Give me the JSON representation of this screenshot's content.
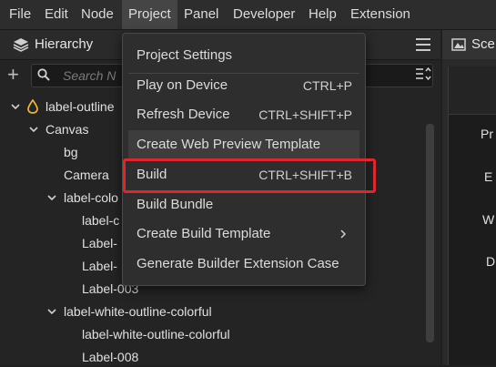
{
  "menubar": {
    "items": [
      "File",
      "Edit",
      "Node",
      "Project",
      "Panel",
      "Developer",
      "Help",
      "Extension"
    ]
  },
  "hierarchy": {
    "title": "Hierarchy",
    "search_placeholder": "Search N",
    "tree": [
      {
        "label": "label-outline"
      },
      {
        "label": "Canvas"
      },
      {
        "label": "bg"
      },
      {
        "label": "Camera"
      },
      {
        "label": "label-colo"
      },
      {
        "label": "label-c"
      },
      {
        "label": "Label-"
      },
      {
        "label": "Label-"
      },
      {
        "label": "Label-003"
      },
      {
        "label": "label-white-outline-colorful"
      },
      {
        "label": "label-white-outline-colorful"
      },
      {
        "label": "Label-008"
      }
    ]
  },
  "scene": {
    "tab_label": "Sce",
    "labels": [
      "Pr",
      "E",
      "W",
      "D"
    ]
  },
  "project_menu": {
    "items": [
      {
        "label": "Project Settings",
        "shortcut": ""
      },
      {
        "label": "Play on Device",
        "shortcut": "CTRL+P"
      },
      {
        "label": "Refresh Device",
        "shortcut": "CTRL+SHIFT+P"
      },
      {
        "label": "Create Web Preview Template",
        "shortcut": ""
      },
      {
        "label": "Build",
        "shortcut": "CTRL+SHIFT+B"
      },
      {
        "label": "Build Bundle",
        "shortcut": ""
      },
      {
        "label": "Create Build Template",
        "shortcut": ""
      },
      {
        "label": "Generate Builder Extension Case",
        "shortcut": ""
      }
    ]
  },
  "colors": {
    "highlight": "#e0262a",
    "accent_icon": "#f0b030"
  }
}
